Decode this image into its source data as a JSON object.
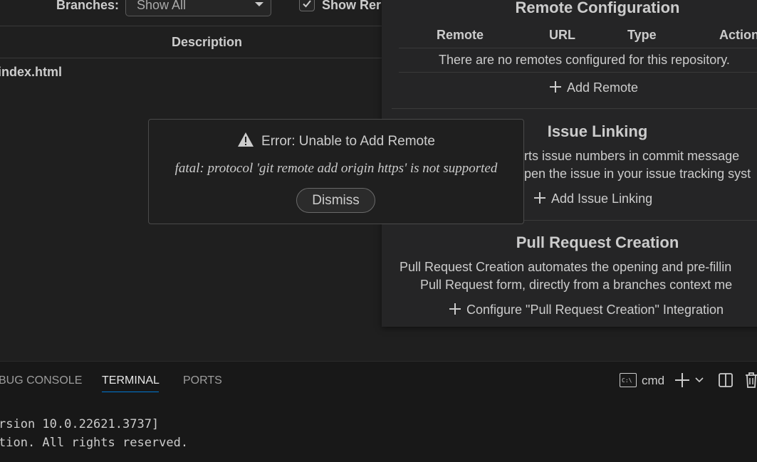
{
  "controls": {
    "branches_label": "Branches:",
    "branches_value": "Show All",
    "show_label": "Show Rer",
    "show_checked": true
  },
  "table": {
    "description_header": "Description",
    "first_row": "index.html"
  },
  "settings": {
    "remote_config": {
      "title": "Remote Configuration",
      "columns": [
        "Remote",
        "URL",
        "Type",
        "Action"
      ],
      "empty_message": "There are no remotes configured for this repository.",
      "add_label": "Add Remote"
    },
    "issue_linking": {
      "title": "Issue Linking",
      "desc_line1": "rts issue numbers in commit message",
      "desc_line2": "pen the issue in your issue tracking syst",
      "add_label": "Add Issue Linking"
    },
    "pull_request": {
      "title": "Pull Request Creation",
      "desc_line1": "Pull Request Creation automates the opening and pre-fillin",
      "desc_line2": "Pull Request form, directly from a branches context me",
      "configure_label": "Configure \"Pull Request Creation\" Integration"
    }
  },
  "error_dialog": {
    "title": "Error: Unable to Add Remote",
    "message": "fatal: protocol 'git remote add origin https' is not supported",
    "dismiss_label": "Dismiss"
  },
  "bottom_panel": {
    "tabs": [
      "BUG CONSOLE",
      "TERMINAL",
      "PORTS"
    ],
    "active_tab": "TERMINAL",
    "profile_icon_text": "C:\\",
    "profile_label": "cmd",
    "terminal_lines": [
      "rsion 10.0.22621.3737]",
      "tion. All rights reserved."
    ]
  },
  "icons": {
    "warning": "warning-triangle-icon",
    "plus": "plus-icon",
    "checkbox_check": "check-icon",
    "split": "split-terminal-icon",
    "trash": "trash-icon",
    "chevron": "chevron-down-icon"
  },
  "colors": {
    "background": "#1f1f1f",
    "panel": "#252526",
    "terminal_bg": "#181818",
    "accent": "#0078d4",
    "text": "#cccccc"
  }
}
